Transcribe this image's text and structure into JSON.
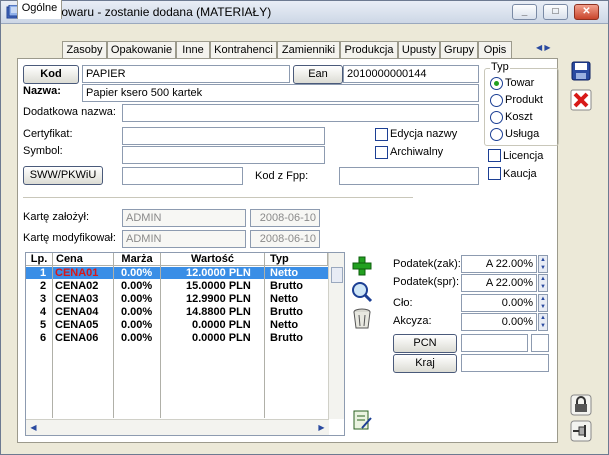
{
  "window": {
    "title": "Karta towaru - zostanie dodana (MATERIAŁY)"
  },
  "tabs": [
    "Ogólne",
    "Zasoby",
    "Opakowanie",
    "Inne",
    "Kontrahenci",
    "Zamienniki",
    "Produkcja",
    "Upusty",
    "Grupy",
    "Opis"
  ],
  "form": {
    "kod_button": "Kod",
    "kod_value": "PAPIER",
    "ean_button": "Ean",
    "ean_value": "2010000000144",
    "nazwa_label": "Nazwa:",
    "nazwa_value": "Papier ksero 500 kartek",
    "dodatkowa_label": "Dodatkowa nazwa:",
    "dodatkowa_value": "",
    "certyfikat_label": "Certyfikat:",
    "certyfikat_value": "",
    "symbol_label": "Symbol:",
    "symbol_value": "",
    "edycja_label": "Edycja nazwy",
    "archiwalny_label": "Archiwalny",
    "sww_button": "SWW/PKWiU",
    "sww_value": "",
    "kodfpp_label": "Kod z Fpp:",
    "kodfpp_value": "",
    "licencja_label": "Licencja",
    "kaucja_label": "Kaucja",
    "zalozyl_label": "Kartę założył:",
    "zalozyl_user": "ADMIN",
    "zalozyl_date": "2008-06-10",
    "modyfikowal_label": "Kartę modyfikował:",
    "modyfikowal_user": "ADMIN",
    "modyfikowal_date": "2008-06-10"
  },
  "typ": {
    "label": "Typ",
    "options": [
      "Towar",
      "Produkt",
      "Koszt",
      "Usługa"
    ],
    "selected": "Towar"
  },
  "table": {
    "headers": [
      "Lp.",
      "Cena",
      "Marża",
      "Wartość",
      "Typ"
    ],
    "rows": [
      {
        "lp": "1",
        "cena": "CENA01",
        "marza": "0.00%",
        "wartosc": "12.0000 PLN",
        "typ": "Netto"
      },
      {
        "lp": "2",
        "cena": "CENA02",
        "marza": "0.00%",
        "wartosc": "15.0000 PLN",
        "typ": "Brutto"
      },
      {
        "lp": "3",
        "cena": "CENA03",
        "marza": "0.00%",
        "wartosc": "12.9900 PLN",
        "typ": "Netto"
      },
      {
        "lp": "4",
        "cena": "CENA04",
        "marza": "0.00%",
        "wartosc": "14.8800 PLN",
        "typ": "Brutto"
      },
      {
        "lp": "5",
        "cena": "CENA05",
        "marza": "0.00%",
        "wartosc": "0.0000 PLN",
        "typ": "Netto"
      },
      {
        "lp": "6",
        "cena": "CENA06",
        "marza": "0.00%",
        "wartosc": "0.0000 PLN",
        "typ": "Brutto"
      }
    ]
  },
  "tax": {
    "zak_label": "Podatek(zak):",
    "zak_value": "A 22.00%",
    "spr_label": "Podatek(spr):",
    "spr_value": "A 22.00%",
    "clo_label": "Cło:",
    "clo_value": "0.00%",
    "akcyza_label": "Akcyza:",
    "akcyza_value": "0.00%",
    "pcn_button": "PCN",
    "kraj_button": "Kraj"
  },
  "colors": {
    "selected_row": "#3a8ee6",
    "selected_cena": "#d81818",
    "accent_green": "#22a020",
    "close_red": "#c8452c"
  }
}
